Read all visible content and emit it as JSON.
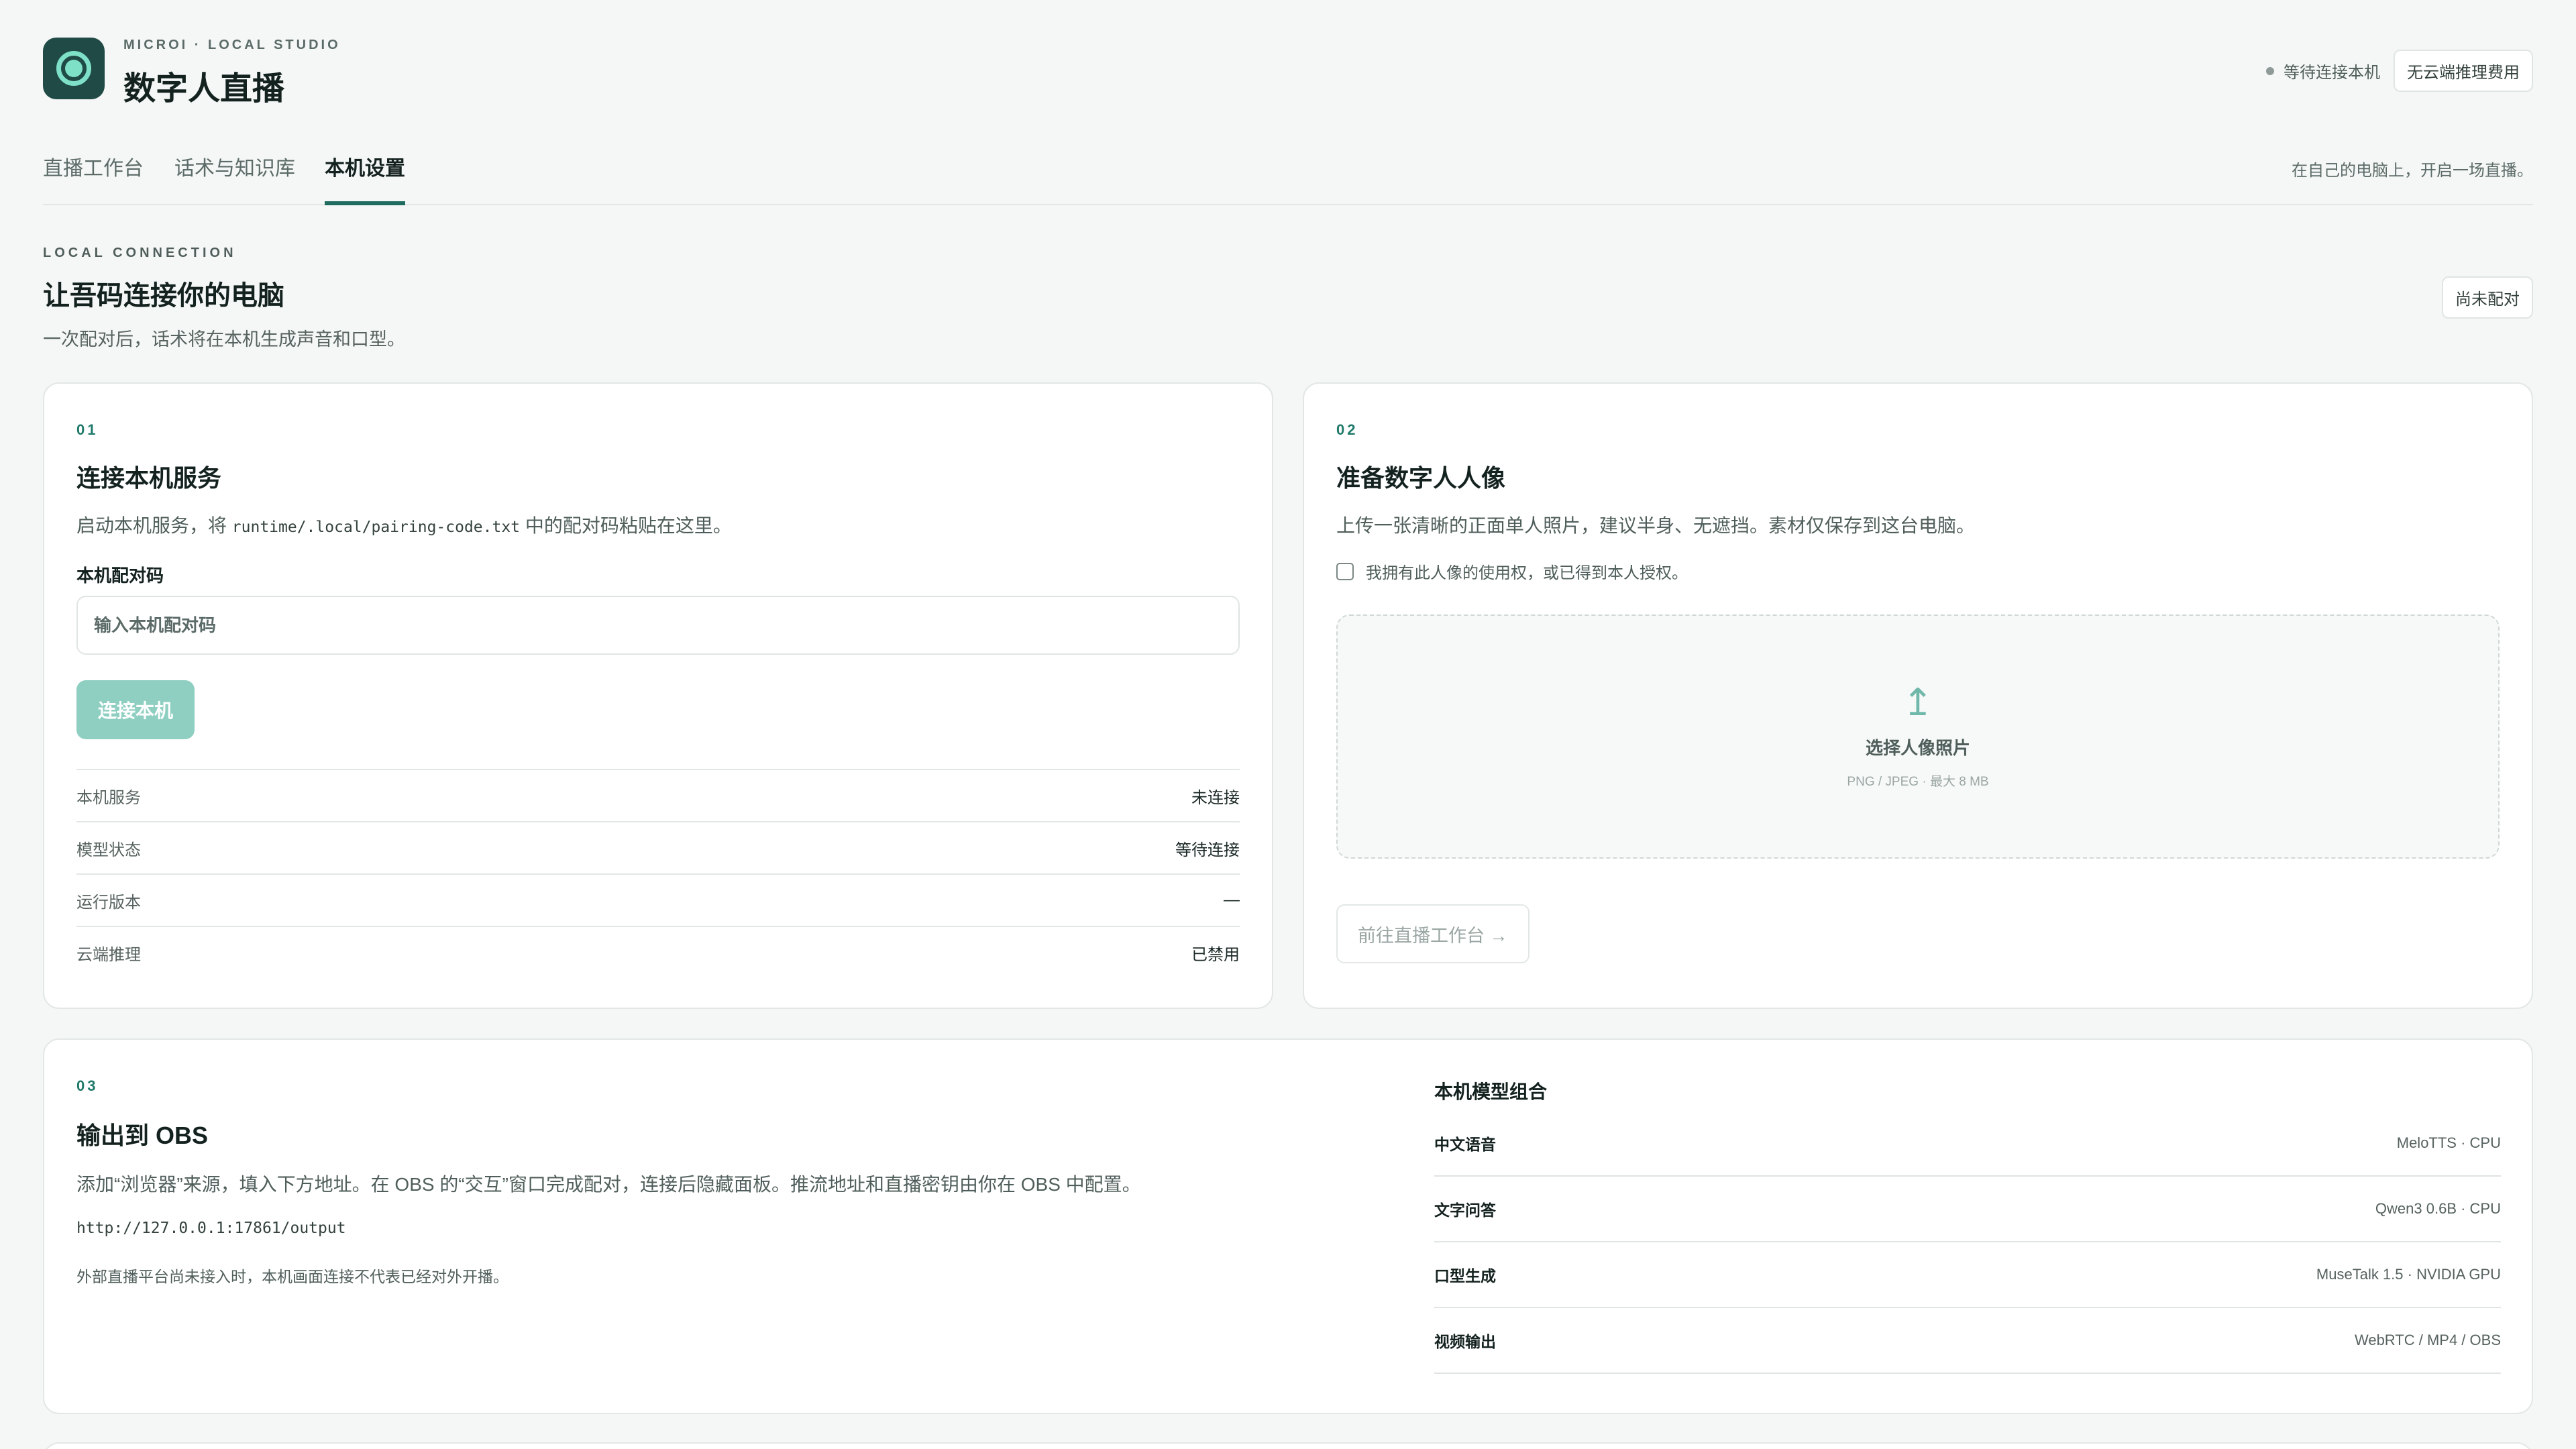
{
  "header": {
    "brand_sub": "MICROI · LOCAL STUDIO",
    "title": "数字人直播",
    "status": "等待连接本机",
    "badge": "无云端推理费用"
  },
  "tabs": {
    "items": [
      {
        "label": "直播工作台"
      },
      {
        "label": "话术与知识库"
      },
      {
        "label": "本机设置"
      }
    ],
    "active": "本机设置",
    "note": "在自己的电脑上，开启一场直播。"
  },
  "section": {
    "eyebrow": "LOCAL CONNECTION",
    "title": "让吾码连接你的电脑",
    "desc": "一次配对后，话术将在本机生成声音和口型。",
    "pair_status": "尚未配对"
  },
  "card1": {
    "num": "01",
    "title": "连接本机服务",
    "desc_pre": "启动本机服务，将 ",
    "desc_code": "runtime/.local/pairing-code.txt",
    "desc_post": " 中的配对码粘贴在这里。",
    "field_label": "本机配对码",
    "input_placeholder": "输入本机配对码",
    "connect_button": "连接本机",
    "status_rows": [
      {
        "key": "本机服务",
        "value": "未连接"
      },
      {
        "key": "模型状态",
        "value": "等待连接"
      },
      {
        "key": "运行版本",
        "value": "—"
      },
      {
        "key": "云端推理",
        "value": "已禁用"
      }
    ]
  },
  "card2": {
    "num": "02",
    "title": "准备数字人人像",
    "desc": "上传一张清晰的正面单人照片，建议半身、无遮挡。素材仅保存到这台电脑。",
    "consent": "我拥有此人像的使用权，或已得到本人授权。",
    "upload_icon": "upload-arrow-icon",
    "upload_label": "选择人像照片",
    "upload_hint": "PNG / JPEG · 最大 8 MB",
    "next_button": "前往直播工作台 →"
  },
  "card3": {
    "num": "03",
    "title": "输出到 OBS",
    "desc": "添加“浏览器”来源，填入下方地址。在 OBS 的“交互”窗口完成配对，连接后隐藏面板。推流地址和直播密钥由你在 OBS 中配置。",
    "url": "http://127.0.0.1:17861/output",
    "note": "外部直播平台尚未接入时，本机画面连接不代表已经对外开播。",
    "models_title": "本机模型组合",
    "models": [
      {
        "key": "中文语音",
        "value": "MeloTTS · CPU"
      },
      {
        "key": "文字问答",
        "value": "Qwen3 0.6B · CPU"
      },
      {
        "key": "口型生成",
        "value": "MuseTalk 1.5 · NVIDIA GPU"
      },
      {
        "key": "视频输出",
        "value": "WebRTC / MP4 / OBS"
      }
    ]
  },
  "colors": {
    "accent": "#1f6b5f",
    "accent_light": "#8fcfc2",
    "logo_bg": "#1f4a45",
    "logo_ring": "#7fe0c8"
  }
}
